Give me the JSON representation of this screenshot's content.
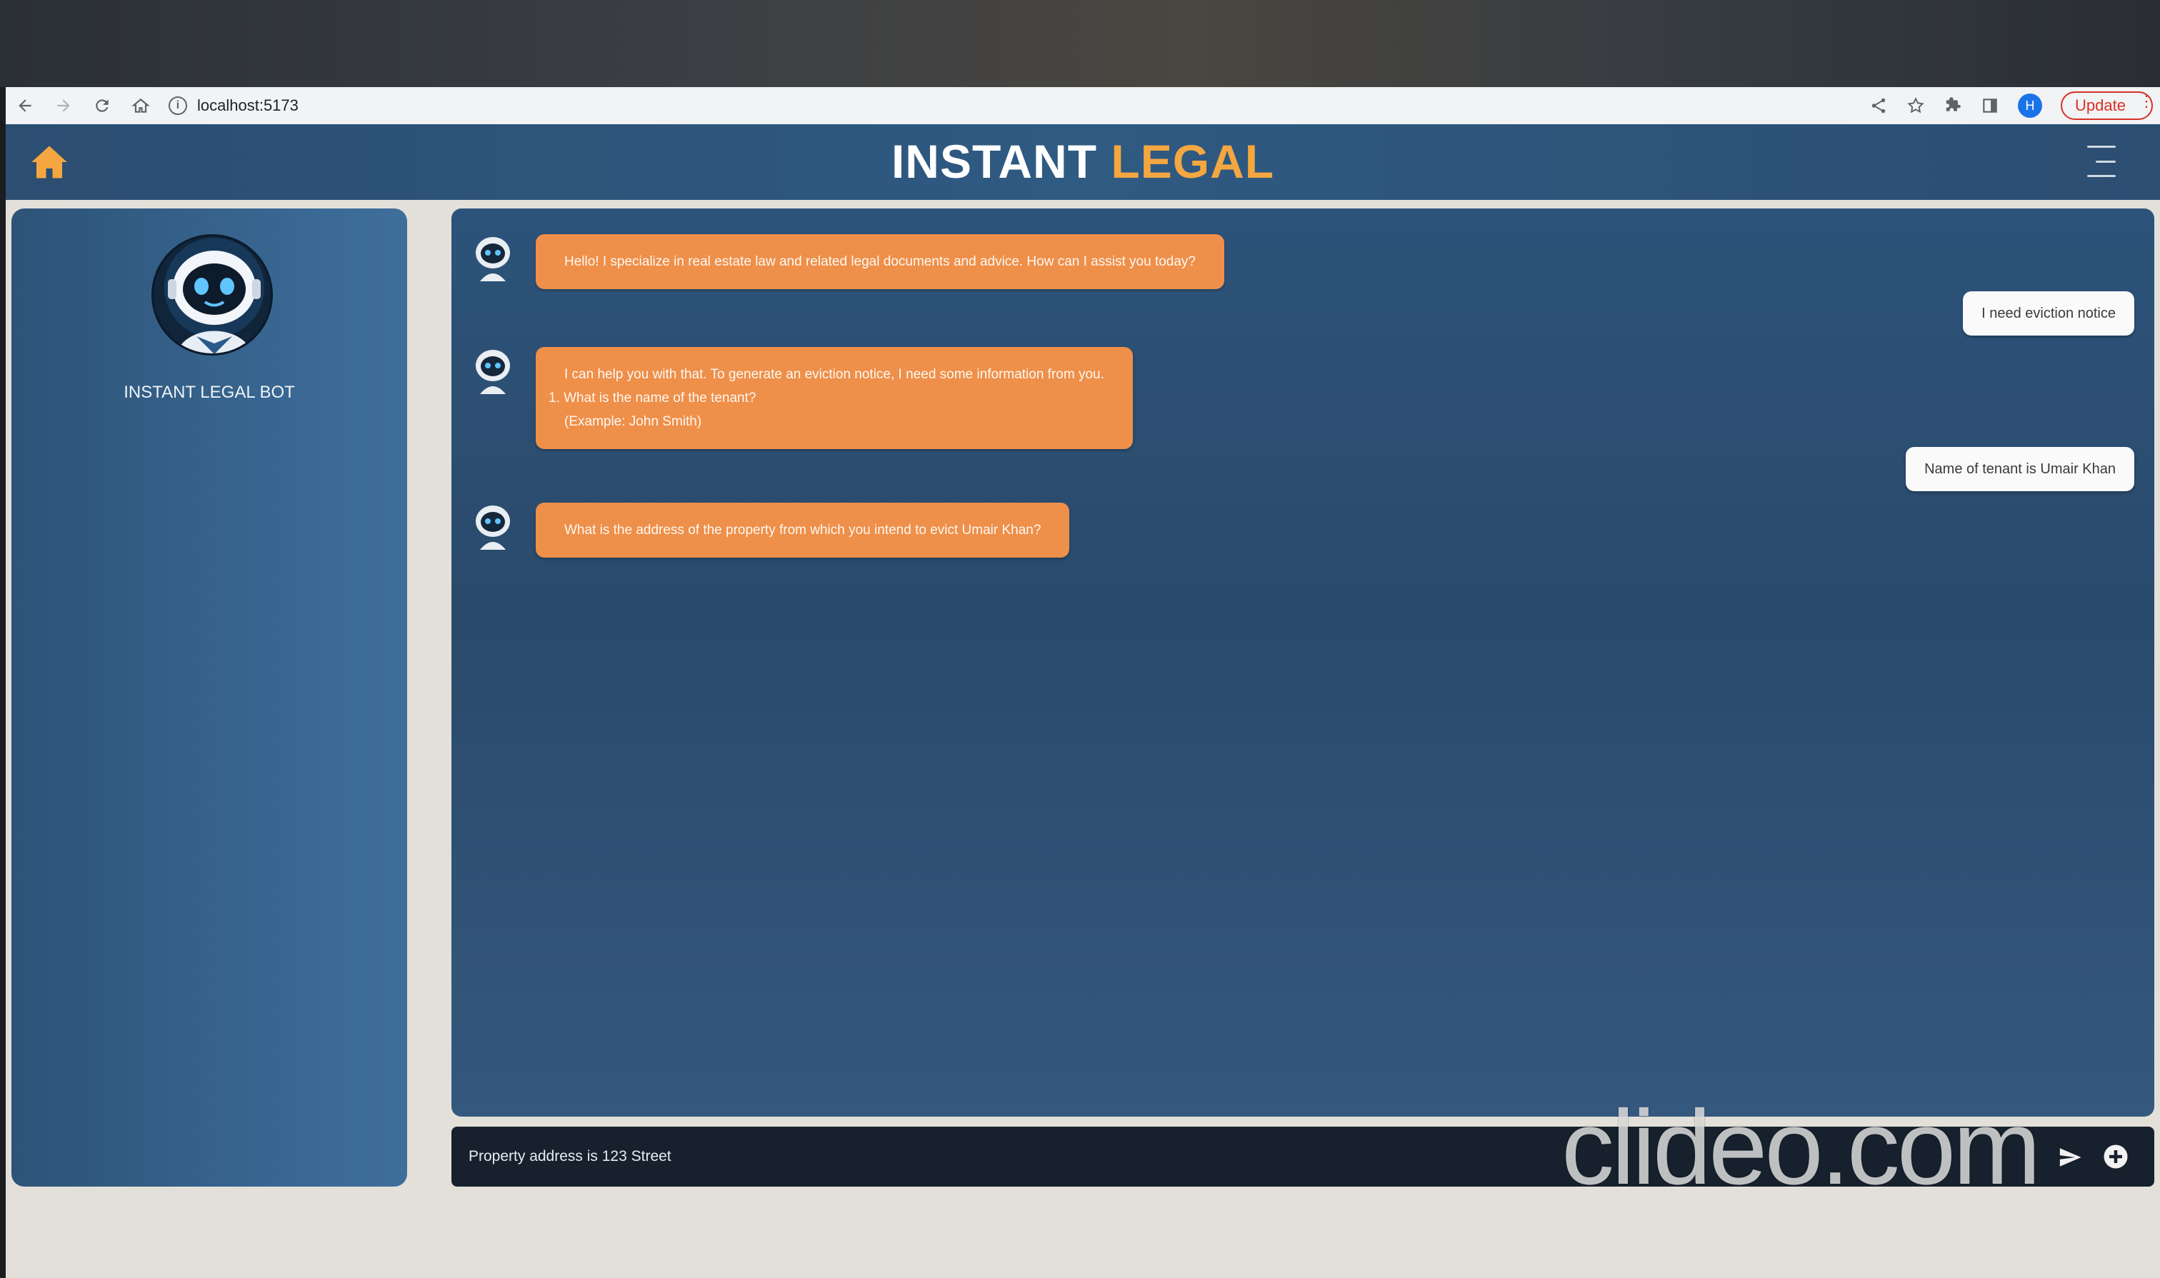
{
  "browser": {
    "url": "localhost:5173",
    "profile_initial": "H",
    "update_label": "Update"
  },
  "app": {
    "title_part1": "INSTANT",
    "title_part2": "LEGAL",
    "bot_name": "INSTANT LEGAL BOT",
    "accent_color": "#ee8f4a"
  },
  "messages": [
    {
      "sender": "bot",
      "lines": [
        "Hello! I specialize in real estate law and related legal documents and advice. How can I assist you today?"
      ]
    },
    {
      "sender": "user",
      "text": "I need eviction notice"
    },
    {
      "sender": "bot",
      "lines": [
        "I can help you with that. To generate an eviction notice, I need some information from you.",
        "1. What is the name of the tenant?",
        "(Example: John Smith)"
      ]
    },
    {
      "sender": "user",
      "text": "Name of tenant is Umair Khan"
    },
    {
      "sender": "bot",
      "lines": [
        "What is the address of the property from which you intend to evict Umair Khan?"
      ]
    }
  ],
  "input": {
    "value": "Property address is 123 Street"
  },
  "watermark": "clideo.com",
  "icons": {
    "home": "home-icon",
    "menu": "hamburger-menu-icon",
    "send": "send-icon",
    "add": "plus-circle-icon"
  }
}
